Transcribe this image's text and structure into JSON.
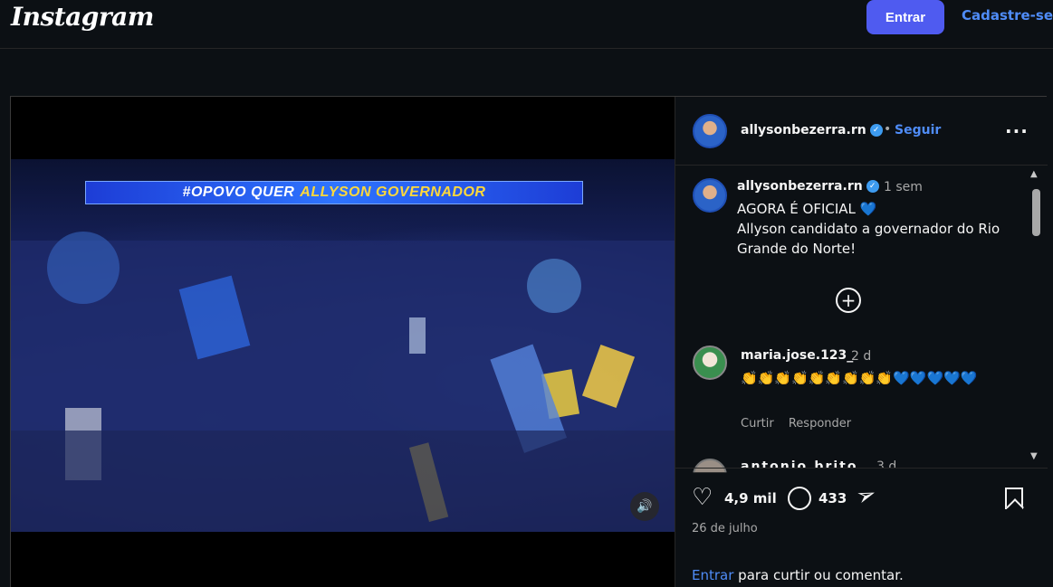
{
  "header": {
    "logo": "Instagram",
    "login_label": "Entrar",
    "signup_label": "Cadastre-se"
  },
  "media": {
    "banner_text": "#OPOVO QUER",
    "banner_name": "ALLYSON GOVERNADOR"
  },
  "post": {
    "username": "allysonbezerra.rn",
    "follow_label": "Seguir",
    "separator": "•",
    "caption_time": "1 sem",
    "caption_line1": "AGORA É OFICIAL",
    "caption_line2": "Allyson candidato a governador do Rio Grande do Norte!",
    "more_label": "···"
  },
  "comments": [
    {
      "username": "maria.jose.123_",
      "time": "2 d",
      "text": "👏👏👏👏👏👏👏👏👏💙💙💙💙💙",
      "like_label": "Curtir",
      "reply_label": "Responder"
    },
    {
      "username": "antonio.brito",
      "time": "3 d"
    }
  ],
  "actions": {
    "likes": "4,9 mil",
    "comments_count": "433",
    "date": "26 de julho",
    "login_link": "Entrar",
    "login_prompt": " para curtir ou comentar."
  },
  "colors": {
    "accent": "#4f5bf0",
    "link": "#4f8cf7",
    "background": "#0c1014",
    "verified": "#3d9bf0"
  }
}
